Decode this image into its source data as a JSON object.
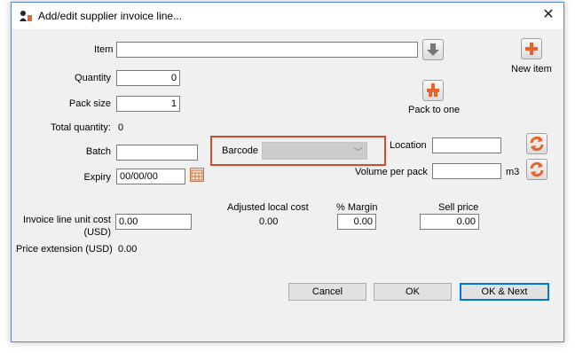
{
  "window": {
    "title": "Add/edit supplier invoice line...",
    "close_glyph": "✕"
  },
  "item": {
    "label": "Item",
    "value": ""
  },
  "quantity": {
    "label": "Quantity",
    "value": "0"
  },
  "pack_size": {
    "label": "Pack size",
    "value": "1"
  },
  "total_quantity": {
    "label": "Total quantity:",
    "value": "0"
  },
  "batch": {
    "label": "Batch",
    "value": ""
  },
  "expiry": {
    "label": "Expiry",
    "value": "00/00/00"
  },
  "barcode": {
    "label": "Barcode",
    "value": ""
  },
  "location": {
    "label": "Location",
    "value": ""
  },
  "volume_per_pack": {
    "label": "Volume per pack",
    "value": "",
    "unit": "m3"
  },
  "new_item": {
    "label": "New item"
  },
  "pack_to_one": {
    "label": "Pack to one"
  },
  "unit_cost": {
    "label_line1": "Invoice line unit cost",
    "label_line2": "(USD)",
    "value": "0.00"
  },
  "adjusted_cost": {
    "label": "Adjusted local cost",
    "value": "0.00"
  },
  "margin": {
    "label": "% Margin",
    "value": "0.00"
  },
  "sell_price": {
    "label": "Sell price",
    "value": "0.00"
  },
  "price_extension": {
    "label": "Price extension (USD)",
    "value": "0.00"
  },
  "buttons": {
    "cancel": "Cancel",
    "ok": "OK",
    "ok_next": "OK & Next"
  },
  "colors": {
    "accent_orange": "#e8622a",
    "highlight_red": "#d9472c",
    "default_button_border": "#0078d7"
  },
  "icons": {
    "app": "app-logo-icon",
    "down_arrow": "down-arrow-icon",
    "plus": "plus-icon",
    "pack": "pack-to-one-icon",
    "refresh": "refresh-icon",
    "calendar": "calendar-icon"
  }
}
